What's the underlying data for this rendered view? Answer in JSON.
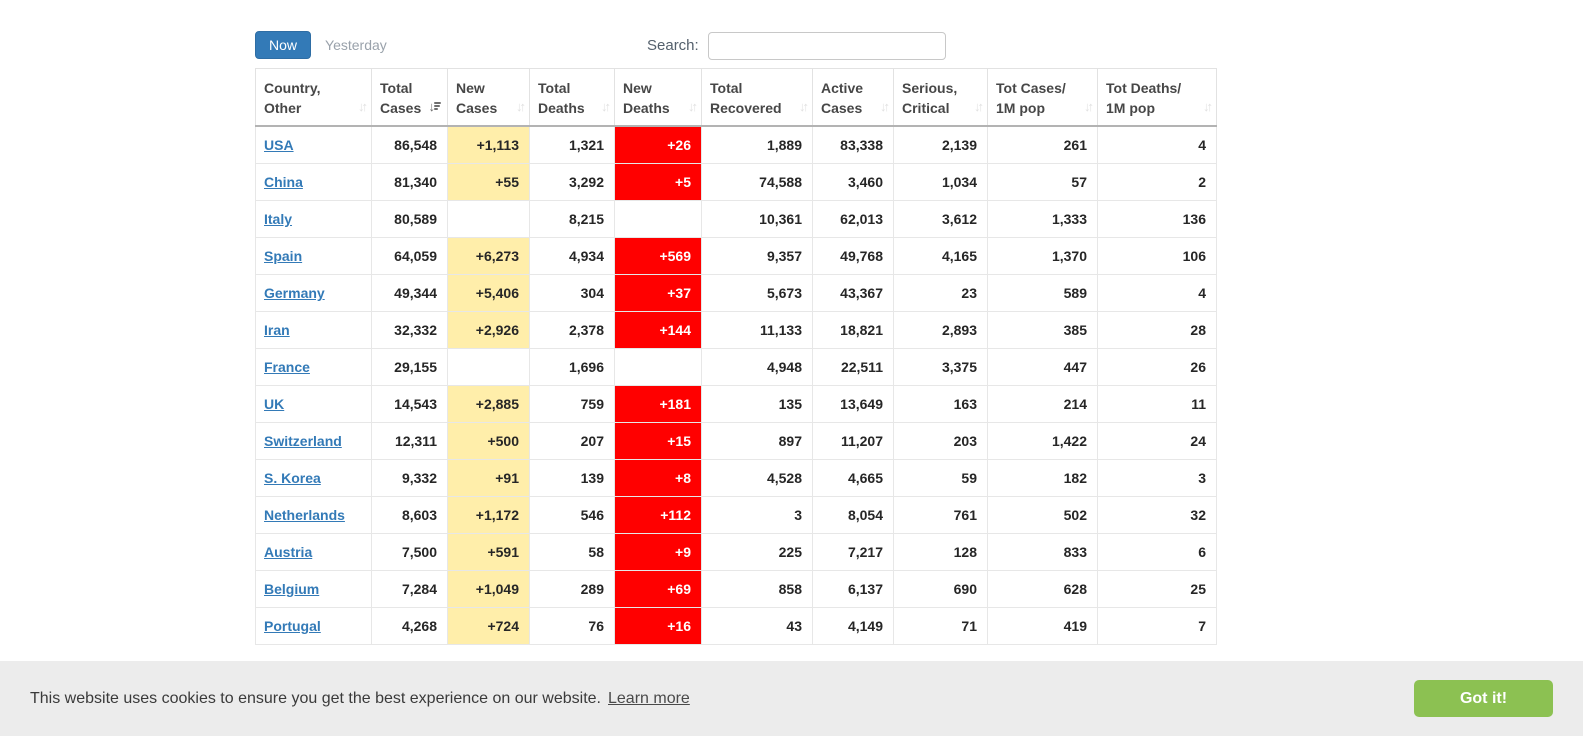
{
  "controls": {
    "now_label": "Now",
    "yesterday_label": "Yesterday",
    "search_label": "Search:",
    "search_value": "",
    "search_placeholder": ""
  },
  "table": {
    "columns": [
      {
        "key": "country",
        "label": "Country,\nOther",
        "icon": "sort-updown-icon",
        "sort": "none"
      },
      {
        "key": "total_cases",
        "label": "Total\nCases",
        "icon": "sort-desc-icon",
        "sort": "desc"
      },
      {
        "key": "new_cases",
        "label": "New\nCases",
        "icon": "sort-updown-icon",
        "sort": "none"
      },
      {
        "key": "total_deaths",
        "label": "Total\nDeaths",
        "icon": "sort-updown-icon",
        "sort": "none"
      },
      {
        "key": "new_deaths",
        "label": "New\nDeaths",
        "icon": "sort-updown-icon",
        "sort": "none"
      },
      {
        "key": "total_recovered",
        "label": "Total\nRecovered",
        "icon": "sort-updown-icon",
        "sort": "none"
      },
      {
        "key": "active_cases",
        "label": "Active\nCases",
        "icon": "sort-updown-icon",
        "sort": "none"
      },
      {
        "key": "serious_critical",
        "label": "Serious,\nCritical",
        "icon": "sort-updown-icon",
        "sort": "none"
      },
      {
        "key": "cases_per_1m",
        "label": "Tot Cases/\n1M pop",
        "icon": "sort-updown-icon",
        "sort": "none"
      },
      {
        "key": "deaths_per_1m",
        "label": "Tot Deaths/\n1M pop",
        "icon": "sort-updown-icon",
        "sort": "none"
      }
    ],
    "rows": [
      {
        "country": "USA",
        "total_cases": "86,548",
        "new_cases": "+1,113",
        "total_deaths": "1,321",
        "new_deaths": "+26",
        "total_recovered": "1,889",
        "active_cases": "83,338",
        "serious_critical": "2,139",
        "cases_per_1m": "261",
        "deaths_per_1m": "4"
      },
      {
        "country": "China",
        "total_cases": "81,340",
        "new_cases": "+55",
        "total_deaths": "3,292",
        "new_deaths": "+5",
        "total_recovered": "74,588",
        "active_cases": "3,460",
        "serious_critical": "1,034",
        "cases_per_1m": "57",
        "deaths_per_1m": "2"
      },
      {
        "country": "Italy",
        "total_cases": "80,589",
        "new_cases": "",
        "total_deaths": "8,215",
        "new_deaths": "",
        "total_recovered": "10,361",
        "active_cases": "62,013",
        "serious_critical": "3,612",
        "cases_per_1m": "1,333",
        "deaths_per_1m": "136"
      },
      {
        "country": "Spain",
        "total_cases": "64,059",
        "new_cases": "+6,273",
        "total_deaths": "4,934",
        "new_deaths": "+569",
        "total_recovered": "9,357",
        "active_cases": "49,768",
        "serious_critical": "4,165",
        "cases_per_1m": "1,370",
        "deaths_per_1m": "106"
      },
      {
        "country": "Germany",
        "total_cases": "49,344",
        "new_cases": "+5,406",
        "total_deaths": "304",
        "new_deaths": "+37",
        "total_recovered": "5,673",
        "active_cases": "43,367",
        "serious_critical": "23",
        "cases_per_1m": "589",
        "deaths_per_1m": "4"
      },
      {
        "country": "Iran",
        "total_cases": "32,332",
        "new_cases": "+2,926",
        "total_deaths": "2,378",
        "new_deaths": "+144",
        "total_recovered": "11,133",
        "active_cases": "18,821",
        "serious_critical": "2,893",
        "cases_per_1m": "385",
        "deaths_per_1m": "28"
      },
      {
        "country": "France",
        "total_cases": "29,155",
        "new_cases": "",
        "total_deaths": "1,696",
        "new_deaths": "",
        "total_recovered": "4,948",
        "active_cases": "22,511",
        "serious_critical": "3,375",
        "cases_per_1m": "447",
        "deaths_per_1m": "26"
      },
      {
        "country": "UK",
        "total_cases": "14,543",
        "new_cases": "+2,885",
        "total_deaths": "759",
        "new_deaths": "+181",
        "total_recovered": "135",
        "active_cases": "13,649",
        "serious_critical": "163",
        "cases_per_1m": "214",
        "deaths_per_1m": "11"
      },
      {
        "country": "Switzerland",
        "total_cases": "12,311",
        "new_cases": "+500",
        "total_deaths": "207",
        "new_deaths": "+15",
        "total_recovered": "897",
        "active_cases": "11,207",
        "serious_critical": "203",
        "cases_per_1m": "1,422",
        "deaths_per_1m": "24"
      },
      {
        "country": "S. Korea",
        "total_cases": "9,332",
        "new_cases": "+91",
        "total_deaths": "139",
        "new_deaths": "+8",
        "total_recovered": "4,528",
        "active_cases": "4,665",
        "serious_critical": "59",
        "cases_per_1m": "182",
        "deaths_per_1m": "3"
      },
      {
        "country": "Netherlands",
        "total_cases": "8,603",
        "new_cases": "+1,172",
        "total_deaths": "546",
        "new_deaths": "+112",
        "total_recovered": "3",
        "active_cases": "8,054",
        "serious_critical": "761",
        "cases_per_1m": "502",
        "deaths_per_1m": "32"
      },
      {
        "country": "Austria",
        "total_cases": "7,500",
        "new_cases": "+591",
        "total_deaths": "58",
        "new_deaths": "+9",
        "total_recovered": "225",
        "active_cases": "7,217",
        "serious_critical": "128",
        "cases_per_1m": "833",
        "deaths_per_1m": "6"
      },
      {
        "country": "Belgium",
        "total_cases": "7,284",
        "new_cases": "+1,049",
        "total_deaths": "289",
        "new_deaths": "+69",
        "total_recovered": "858",
        "active_cases": "6,137",
        "serious_critical": "690",
        "cases_per_1m": "628",
        "deaths_per_1m": "25"
      },
      {
        "country": "Portugal",
        "total_cases": "4,268",
        "new_cases": "+724",
        "total_deaths": "76",
        "new_deaths": "+16",
        "total_recovered": "43",
        "active_cases": "4,149",
        "serious_critical": "71",
        "cases_per_1m": "419",
        "deaths_per_1m": "7"
      }
    ]
  },
  "cookie_banner": {
    "message": "This website uses cookies to ensure you get the best experience on our website.",
    "learn_more_label": "Learn more",
    "got_it_label": "Got it!"
  },
  "colors": {
    "accent_blue": "#337ab7",
    "link_blue": "#337ab7",
    "highlight_yellow": "#ffeeaa",
    "highlight_red": "#ff0000",
    "button_green": "#8cc152"
  }
}
